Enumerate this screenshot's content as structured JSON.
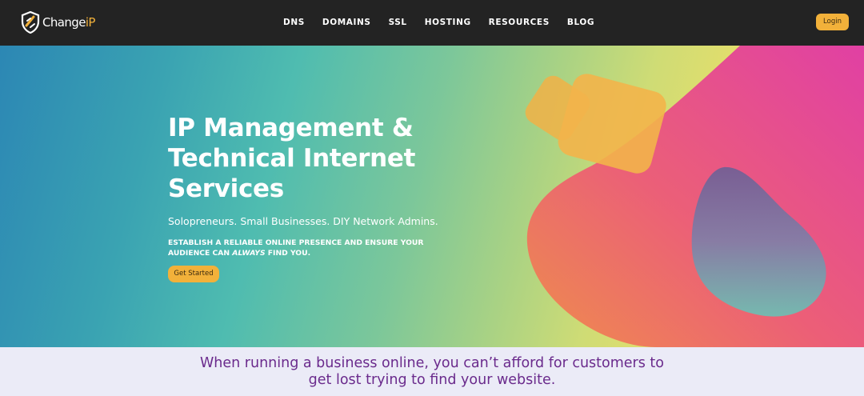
{
  "brand": {
    "name_main": "Change",
    "name_accent": "iP",
    "accent_color": "#f2b13a"
  },
  "nav": {
    "items": [
      {
        "label": "DNS"
      },
      {
        "label": "DOMAINS"
      },
      {
        "label": "SSL"
      },
      {
        "label": "HOSTING"
      },
      {
        "label": "RESOURCES"
      },
      {
        "label": "BLOG"
      }
    ],
    "login_label": "Login"
  },
  "hero": {
    "title": "IP Management & Technical Internet Services",
    "subtitle": "Solopreneurs. Small Businesses. DIY Network Admins.",
    "caps_line_pre": "ESTABLISH A RELIABLE ONLINE PRESENCE AND ENSURE YOUR AUDIENCE CAN",
    "caps_emphasis": "ALWAYS",
    "caps_line_post": "FIND YOU.",
    "cta_label": "Get Started"
  },
  "band": {
    "line1": "When running a business online, you can’t afford for customers to",
    "line2": "get lost trying to find your website."
  },
  "icons": {
    "logo": "shield-logo-icon"
  },
  "colors": {
    "header_bg": "#232323",
    "button": "#f2b13a",
    "band_text": "#6a2a8c",
    "band_bg": "#ebebf7"
  }
}
